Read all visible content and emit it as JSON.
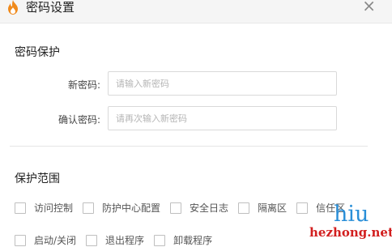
{
  "window": {
    "title": "密码设置",
    "close_glyph": "×"
  },
  "password_section": {
    "title": "密码保护",
    "new_password": {
      "label": "新密码:",
      "placeholder": "请输入新密码",
      "value": ""
    },
    "confirm_password": {
      "label": "确认密码:",
      "placeholder": "请再次输入新密码",
      "value": ""
    }
  },
  "scope_section": {
    "title": "保护范围",
    "options_row1": [
      {
        "label": "访问控制",
        "checked": false
      },
      {
        "label": "防护中心配置",
        "checked": false
      },
      {
        "label": "安全日志",
        "checked": false
      },
      {
        "label": "隔离区",
        "checked": false
      },
      {
        "label": "信任区",
        "checked": false
      }
    ],
    "options_row2": [
      {
        "label": "启动/关闭",
        "checked": false
      },
      {
        "label": "退出程序",
        "checked": false
      },
      {
        "label": "卸载程序",
        "checked": false
      }
    ]
  },
  "watermark": {
    "text_1": "hiu",
    "text_2": "hezhong.net"
  },
  "colors": {
    "titlebar_bg": "#f5f5f5",
    "flame_outer": "#f08a1c",
    "flame_inner": "#ffffff",
    "watermark_blue": "#2a8fd8",
    "watermark_red": "#d21e1e"
  },
  "icons": {
    "app": "flame-icon",
    "close": "close-icon"
  }
}
